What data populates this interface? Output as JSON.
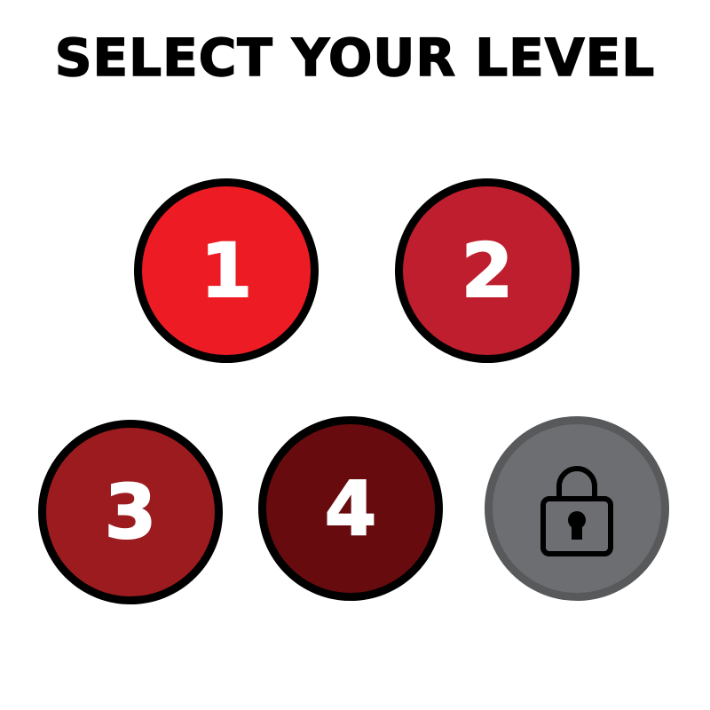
{
  "title": "SELECT YOUR LEVEL",
  "levels": [
    {
      "label": "1",
      "color": "#ed1c24",
      "locked": false
    },
    {
      "label": "2",
      "color": "#be1e2d",
      "locked": false
    },
    {
      "label": "3",
      "color": "#9b1b1f",
      "locked": false
    },
    {
      "label": "4",
      "color": "#680b0e",
      "locked": false
    }
  ],
  "locked_level": {
    "icon": "lock-icon",
    "color": "#6d6e71",
    "border_color": "#58595b",
    "locked": true
  },
  "outline_color": "#000000"
}
